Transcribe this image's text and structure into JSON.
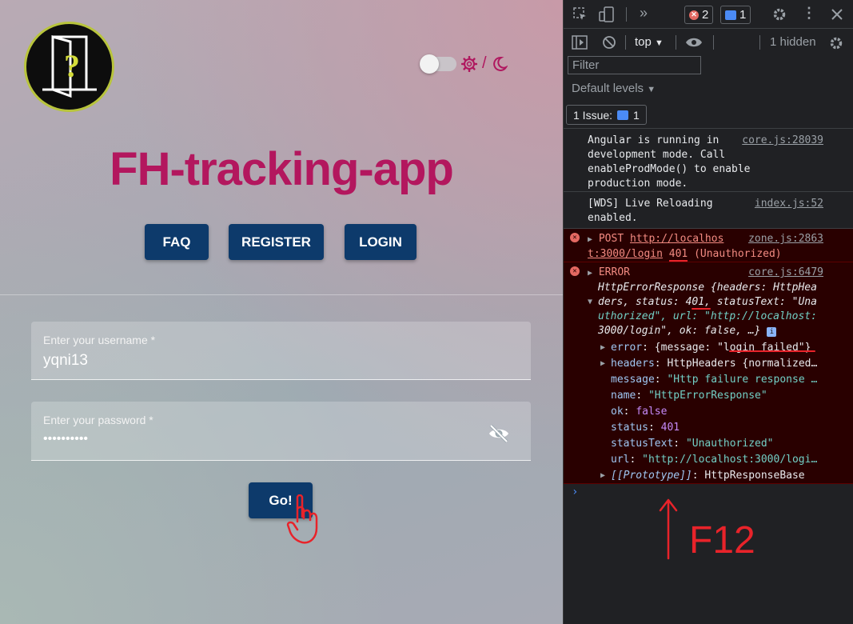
{
  "app": {
    "title": "FH-tracking-app",
    "theme_separator": "/",
    "nav": {
      "faq": "FAQ",
      "register": "REGISTER",
      "login": "LOGIN"
    },
    "form": {
      "username_label": "Enter your username *",
      "username_value": "yqni13",
      "password_label": "Enter your password *",
      "password_value": "••••••••••",
      "submit_label": "Go!"
    },
    "colors": {
      "brand": "#b3175e",
      "button": "#0d3a6b"
    }
  },
  "devtools": {
    "error_count": "2",
    "message_count": "1",
    "context": "top",
    "hidden": "1 hidden",
    "filter_placeholder": "Filter",
    "levels": "Default levels",
    "issues": "1 Issue:",
    "issues_count": "1",
    "logs": {
      "angular": {
        "text": [
          "Angular is running in",
          "development mode. Call",
          "enableProdMode() to enable",
          "production mode."
        ],
        "src": "core.js:28039"
      },
      "wds": {
        "text": [
          "[WDS] Live Reloading",
          "enabled."
        ],
        "src": "index.js:52"
      },
      "post": {
        "method": "POST",
        "url1": "http://localhos",
        "url2": "t:3000/login",
        "status": "401",
        "status_text": "(Unauthorized)",
        "src": "zone.js:2863"
      },
      "error": {
        "label": "ERROR",
        "src": "core.js:6479",
        "summary1": "HttpErrorResponse {headers: HttpHea",
        "summary2": "ders, status: 401, statusText: \"Una",
        "summary3": "uthorized\", url: \"http://localhost:",
        "summary4": "3000/login\", ok: false, …}",
        "props": [
          {
            "key": "error",
            "val": "{message: \"login failed\"}"
          },
          {
            "key": "headers",
            "val": "HttpHeaders {normalized…"
          },
          {
            "key": "message",
            "val": "\"Http failure response …"
          },
          {
            "key": "name",
            "val": "\"HttpErrorResponse\""
          },
          {
            "key": "ok",
            "val": "false"
          },
          {
            "key": "status",
            "val": "401"
          },
          {
            "key": "statusText",
            "val": "\"Unauthorized\""
          },
          {
            "key": "url",
            "val": "\"http://localhost:3000/logi…"
          },
          {
            "key": "[[Prototype]]",
            "val": "HttpResponseBase"
          }
        ]
      }
    },
    "prompt": "›"
  },
  "annotation": "F12"
}
